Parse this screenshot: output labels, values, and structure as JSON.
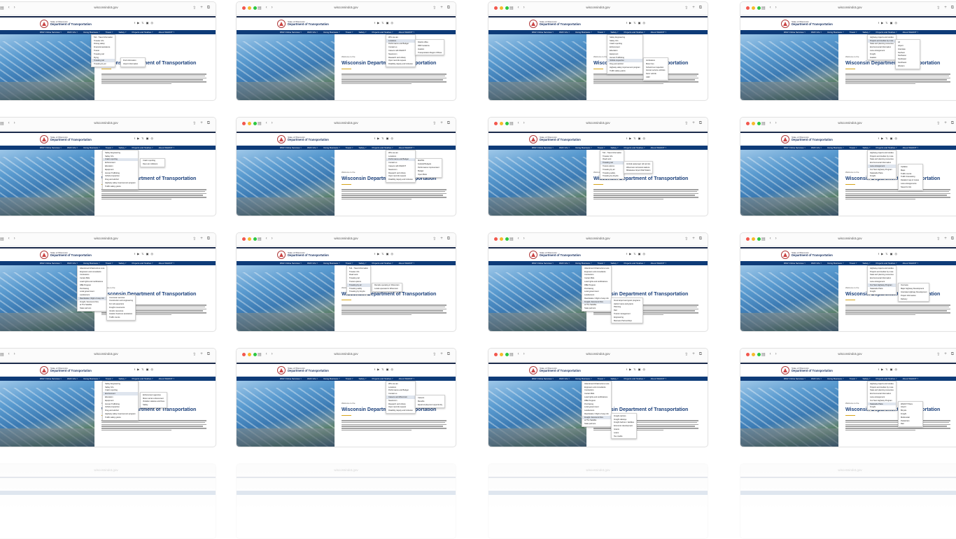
{
  "browser": {
    "url": "wisconsindot.gov"
  },
  "site": {
    "state_label": "State of Wisconsin",
    "dept_label": "Department of Transportation",
    "social_icons": "f ▶ 𝕏 ▣ ◎",
    "top_strip_text": "Wisconsin.gov"
  },
  "nav": {
    "items": [
      "DMV Online Services",
      "DMV Info",
      "Doing Business",
      "Travel",
      "Safety",
      "Projects and Studies",
      "About WisDOT"
    ]
  },
  "content": {
    "welcome": "Welcome to the",
    "title": "Wisconsin Department of Transportation"
  },
  "tiles": [
    {
      "menus": [
        {
          "items": [
            "511 - Travel information",
            "Traveler info",
            "Driving safely",
            "Financial assistance",
            "Transit",
            "Traveling rail",
            "Flying",
            "Traveling rail",
            "Traveling by air"
          ],
          "hl": 7
        },
        {
          "items": [
            "Find information",
            "Airport information"
          ],
          "hl": -1
        }
      ]
    },
    {
      "menus": [
        {
          "items": [
            "Who we are",
            "Locations",
            "Performance and Budget",
            "Contact us",
            "Careers with WisDOT",
            "Newsroom",
            "Research and Library",
            "Open records request",
            "Disability, Equity and Inclusion"
          ],
          "hl": 1
        },
        {
          "items": [
            "District office",
            "DMV locations",
            "Aviation",
            "Transportation Region Offices"
          ],
          "hl": -1
        }
      ]
    },
    {
      "menus": [
        {
          "items": [
            "Safety Engineering",
            "Safety Info",
            "Crash reporting",
            "Enforcement",
            "Education",
            "Equipment",
            "Human Trafficking",
            "Vehicle inspection",
            "Drug and alcohol",
            "Highway safety improvement program",
            "Traffic safety grants"
          ],
          "hl": 7
        },
        {
          "items": [
            "Ambulance",
            "Motor bus",
            "School bus inspection",
            "Human service vehicles",
            "Farm vehicle",
            "CMV"
          ],
          "hl": -1
        }
      ]
    },
    {
      "menus": [
        {
          "items": [
            "Highway projects and studies",
            "Projects and studies by route",
            "State and planning resources",
            "Environmental information",
            "Lane arrangement",
            "Freight",
            "Aviation"
          ],
          "hl": 1
        },
        {
          "items": [
            "All",
            "Airport",
            "Interstate",
            "Northern",
            "Northwest",
            "Southeast",
            "Southwest",
            "Western"
          ],
          "hl": -1
        }
      ]
    },
    {
      "menus": [
        {
          "items": [
            "Safety Engineering",
            "Safety Info",
            "Crash reporting",
            "Enforcement",
            "Education",
            "Equipment",
            "Human Trafficking",
            "Vehicle inspection",
            "Drug and alcohol",
            "Highway safety improvement program",
            "Traffic safety grants"
          ],
          "hl": 2
        },
        {
          "items": [
            "Crash reporting",
            "Deer-car collisions"
          ],
          "hl": -1
        }
      ]
    },
    {
      "menus": [
        {
          "items": [
            "Who we are",
            "Locations",
            "Performance and Budget",
            "Contact us",
            "Careers with WisDOT",
            "Newsroom",
            "Research and Library",
            "Open records request",
            "Disability, Equity and Inclusion"
          ],
          "hl": 2
        },
        {
          "items": [
            "MAPSS",
            "Federal Budgets",
            "Performance Improvement",
            "Budget",
            "Open Book"
          ],
          "hl": -1
        }
      ]
    },
    {
      "menus": [
        {
          "items": [
            "511 - Travel information",
            "Traveler info",
            "Road work",
            "Traveling rail",
            "Transit options",
            "Traveling by air",
            "Traveling safely",
            "Traveling by bicycle"
          ],
          "hl": 3
        },
        {
          "items": [
            "Amtrak passenger rail service",
            "Wisconsin rail transit stations",
            "Milwaukee Airport Rail Station"
          ],
          "hl": -1
        }
      ]
    },
    {
      "menus": [
        {
          "items": [
            "Highway projects and studies",
            "Projects and studies by route",
            "State and planning resources",
            "Environmental information",
            "Lane arrangement",
            "Our Next Highway Program",
            "Statewide Plans",
            "Freight"
          ],
          "hl": 4
        },
        {
          "items": [
            "Updates",
            "Maps",
            "Traffic counts",
            "Traffic forecasting",
            "Detailed map of routes",
            "Lane arrangements",
            "Speed Limits"
          ],
          "hl": -1
        }
      ]
    },
    {
      "menus": [
        {
          "items": [
            "Abandoned Infrastructure Loss",
            "Engineers and consultants",
            "Contractors",
            "Certain Bids",
            "Load rights and certifications",
            "DBE Program",
            "Purchasing",
            "Local government",
            "Landowners",
            "Real Estate / Right of way info",
            "Freight / Economic Dev",
            "at The Satellite",
            "State partners"
          ],
          "hl": 9
        },
        {
          "items": [
            "Commuter services",
            "Construction and engineering",
            "For rail supporters",
            "Freight movements",
            "Vendor resources",
            "Aviation business assistance",
            "Traffic counts"
          ],
          "hl": -1
        }
      ]
    },
    {
      "menus": [
        {
          "items": [
            "511 - Travel information",
            "Traveler info",
            "Road work",
            "Traveling rail",
            "Transit options",
            "Traveling by air",
            "Traveling safely",
            "Traveling by bicycle"
          ],
          "hl": 5
        },
        {
          "items": [
            "Rentals operating in Wisconsin",
            "Locals operated in Wisconsin"
          ],
          "hl": -1
        }
      ]
    },
    {
      "menus": [
        {
          "items": [
            "Abandoned Infrastructure Loss",
            "Engineers and consultants",
            "Contractors",
            "Certain Bids",
            "Load rights and certifications",
            "DBE Program",
            "Purchasing",
            "Local government",
            "Landowners",
            "Real Estate / Right of way info",
            "Freight / Economic Dev",
            "at The Satellite",
            "State partners"
          ],
          "hl": 10
        },
        {
          "items": [
            "Fixed airport and grant programs",
            "Harbor loans and grants",
            "Planning",
            "Rail",
            "Transit management",
            "Engineering",
            "Business Partnerships"
          ],
          "hl": -1
        }
      ]
    },
    {
      "menus": [
        {
          "items": [
            "Highway projects and studies",
            "Projects and studies by route",
            "State and planning resources",
            "Environmental information",
            "Lane arrangement",
            "Our Next Highway Program",
            "Statewide Plans",
            "Freight"
          ],
          "hl": 5
        },
        {
          "items": [
            "Overview",
            "Major Highway Development",
            "Interstate Highway Development",
            "Project Information",
            "Delivery"
          ],
          "hl": -1
        }
      ]
    },
    {
      "menus": [
        {
          "items": [
            "Safety Engineering",
            "Safety Info",
            "Crash reporting",
            "Environment",
            "Education",
            "Equipment",
            "Human Trafficking",
            "Vehicle inspection",
            "Drug and alcohol",
            "Highway safety improvement program",
            "Traffic safety grants"
          ],
          "hl": 3
        },
        {
          "items": [
            "Enforcement agencies",
            "Motor carrier enforcement",
            "Violation statutes and fines",
            "Safety"
          ],
          "hl": -1
        }
      ]
    },
    {
      "menus": [
        {
          "items": [
            "Who we are",
            "Locations",
            "Performance and Budget",
            "Contact us",
            "Careers and Wisconsin",
            "Newsroom",
            "Research and Library",
            "Open records request",
            "Disability, Equity and Inclusion"
          ],
          "hl": 4
        },
        {
          "items": [
            "Careers",
            "Benefits",
            "Equal employment opportunity"
          ],
          "hl": -1
        }
      ]
    },
    {
      "menus": [
        {
          "items": [
            "Abandoned Infrastructure Loss",
            "Engineers and consultants",
            "Contractors",
            "Certain Bids",
            "Load rights and certifications",
            "DBE Program",
            "Purchasing",
            "Local government",
            "Landowners",
            "Real Estate / Right of way info",
            "Freight / Economic Dev",
            "at The Satellite",
            "State partners"
          ],
          "hl": 10
        },
        {
          "items": [
            "Freight carriers",
            "Freight railways",
            "Freight harbors / facilities",
            "Economic development",
            "Grants",
            "Loans",
            "Tax credits"
          ],
          "hl": -1
        }
      ]
    },
    {
      "menus": [
        {
          "items": [
            "Highway projects and studies",
            "Projects and studies by route",
            "State and planning resources",
            "Environmental information",
            "Lane arrangement",
            "Our Next Highway Program",
            "Statewide Plans",
            "Freight"
          ],
          "hl": 6
        },
        {
          "items": [
            "WisDOT Plans",
            "Airport",
            "Bicycle",
            "Freight",
            "Multimodal",
            "Pedestrian",
            "Rail"
          ],
          "hl": -1
        }
      ]
    }
  ]
}
